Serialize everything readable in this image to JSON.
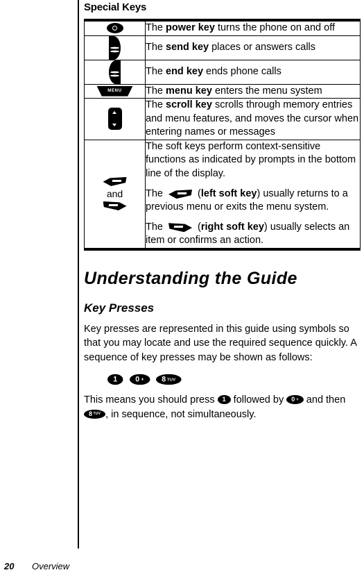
{
  "section_heading": "Special Keys",
  "table": {
    "rows": [
      {
        "icon": "power-key-icon",
        "lines": [
          {
            "parts": [
              {
                "t": "The ",
                "b": false
              },
              {
                "t": "power key",
                "b": true
              },
              {
                "t": " turns the phone on and off",
                "b": false
              }
            ]
          }
        ]
      },
      {
        "icon": "send-key-icon",
        "lines": [
          {
            "parts": [
              {
                "t": "The ",
                "b": false
              },
              {
                "t": "send key",
                "b": true
              },
              {
                "t": " places or answers calls",
                "b": false
              }
            ]
          }
        ]
      },
      {
        "icon": "end-key-icon",
        "lines": [
          {
            "parts": [
              {
                "t": "The ",
                "b": false
              },
              {
                "t": "end key",
                "b": true
              },
              {
                "t": " ends phone calls",
                "b": false
              }
            ]
          }
        ]
      },
      {
        "icon": "menu-key-icon",
        "icon_label": "MENU",
        "lines": [
          {
            "parts": [
              {
                "t": "The ",
                "b": false
              },
              {
                "t": "menu key",
                "b": true
              },
              {
                "t": " enters the menu system",
                "b": false
              }
            ]
          }
        ]
      },
      {
        "icon": "scroll-key-icon",
        "lines": [
          {
            "parts": [
              {
                "t": "The ",
                "b": false
              },
              {
                "t": "scroll key",
                "b": true
              },
              {
                "t": " scrolls through memory entries and menu features, and moves the cursor when entering names or messages",
                "b": false
              }
            ]
          }
        ]
      },
      {
        "icon": "soft-keys-icon",
        "icon_conjunction": "and",
        "lines": [
          {
            "parts": [
              {
                "t": "The soft keys perform context-sensitive functions as indicated by prompts in the bottom line of the display.",
                "b": false
              }
            ]
          },
          {
            "parts": [
              {
                "t": "The ",
                "b": false
              },
              {
                "icon": "left-soft-key-icon"
              },
              {
                "t": " (",
                "b": false
              },
              {
                "t": "left soft key",
                "b": true
              },
              {
                "t": ") usually returns to a previous menu or exits the menu system.",
                "b": false
              }
            ]
          },
          {
            "parts": [
              {
                "t": "The ",
                "b": false
              },
              {
                "icon": "right-soft-key-icon"
              },
              {
                "t": " (",
                "b": false
              },
              {
                "t": "right soft key",
                "b": true
              },
              {
                "t": ") usually selects an item or confirms an action.",
                "b": false
              }
            ]
          }
        ]
      }
    ]
  },
  "chapter_title": "Understanding the Guide",
  "subsection_title": "Key Presses",
  "intro_paragraph": "Key presses are represented in this guide using symbols so that you may locate and use the required sequence quickly. A sequence of key presses may be shown as follows:",
  "key_sequence": [
    {
      "label": "1",
      "sub": "",
      "plus": false
    },
    {
      "label": "0",
      "sub": "",
      "plus": true
    },
    {
      "label": "8",
      "sub": "TUV",
      "plus": false
    }
  ],
  "explanation": {
    "p1": "This means you should press ",
    "p2": " followed by ",
    "p3": " and then ",
    "p4": ", in sequence, not simultaneously.",
    "key1": {
      "label": "1",
      "sub": "",
      "plus": false
    },
    "key2": {
      "label": "0",
      "sub": "",
      "plus": true
    },
    "key3": {
      "label": "8",
      "sub": "TUV",
      "plus": false
    }
  },
  "footer": {
    "page_number": "20",
    "section_name": "Overview"
  }
}
